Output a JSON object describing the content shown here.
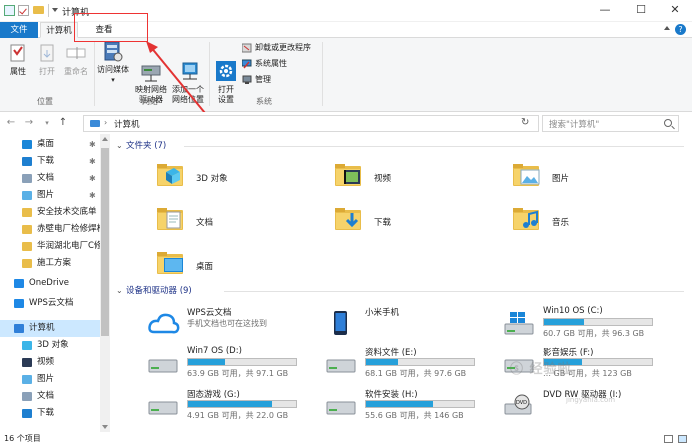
{
  "window": {
    "title": "计算机",
    "minimize": "—",
    "maximize": "☐",
    "close": "✕"
  },
  "tabs": {
    "file": "文件",
    "computer": "计算机",
    "view": "查看"
  },
  "ribbon": {
    "location": {
      "label": "位置",
      "properties": "属性",
      "open": "打开",
      "rename": "重命名"
    },
    "network": {
      "label": "网络",
      "access_media": "访问媒体",
      "map_drive": "映射网络\n驱动器",
      "add_location": "添加一个\n网络位置"
    },
    "system": {
      "label": "系统",
      "open_settings": "打开\n设置",
      "uninstall": "卸载或更改程序",
      "system_properties": "系统属性",
      "manage": "管理"
    }
  },
  "address": {
    "path": "计算机",
    "search_placeholder": "搜索\"计算机\""
  },
  "nav_pane": {
    "items": [
      {
        "label": "桌面",
        "pinned": true,
        "icon": "desktop-icon"
      },
      {
        "label": "下载",
        "pinned": true,
        "icon": "download-icon"
      },
      {
        "label": "文档",
        "pinned": true,
        "icon": "document-icon"
      },
      {
        "label": "图片",
        "pinned": true,
        "icon": "picture-icon"
      },
      {
        "label": "安全技术交底单",
        "pinned": false,
        "icon": "folder-icon"
      },
      {
        "label": "赤壁电厂检修焊材",
        "pinned": false,
        "icon": "folder-icon"
      },
      {
        "label": "华润湖北电厂C修",
        "pinned": false,
        "icon": "folder-icon"
      },
      {
        "label": "施工方案",
        "pinned": false,
        "icon": "folder-icon"
      },
      {
        "label": "OneDrive",
        "pinned": false,
        "icon": "cloud-icon"
      },
      {
        "label": "WPS云文档",
        "pinned": false,
        "icon": "cloud-icon"
      },
      {
        "label": "计算机",
        "pinned": false,
        "icon": "computer-icon"
      },
      {
        "label": "3D 对象",
        "pinned": false,
        "icon": "3d-icon"
      },
      {
        "label": "视频",
        "pinned": false,
        "icon": "video-icon"
      },
      {
        "label": "图片",
        "pinned": false,
        "icon": "picture-icon"
      },
      {
        "label": "文档",
        "pinned": false,
        "icon": "document-icon"
      },
      {
        "label": "下载",
        "pinned": false,
        "icon": "download-icon"
      }
    ]
  },
  "folders": {
    "header": "文件夹 (7)",
    "items": [
      {
        "label": "3D 对象",
        "icon": "3d-objects-icon"
      },
      {
        "label": "视频",
        "icon": "video-folder-icon"
      },
      {
        "label": "图片",
        "icon": "picture-folder-icon"
      },
      {
        "label": "文档",
        "icon": "document-folder-icon"
      },
      {
        "label": "下载",
        "icon": "download-folder-icon"
      },
      {
        "label": "音乐",
        "icon": "music-folder-icon"
      },
      {
        "label": "桌面",
        "icon": "desktop-folder-icon"
      }
    ]
  },
  "devices": {
    "header": "设备和驱动器 (9)",
    "items": [
      {
        "name": "WPS云文档",
        "info": "手机文档也可在这找到",
        "fill": null,
        "icon": "wps-cloud-icon"
      },
      {
        "name": "小米手机",
        "info": "",
        "fill": null,
        "icon": "phone-icon"
      },
      {
        "name": "Win10 OS (C:)",
        "info": "60.7 GB 可用，共 96.3 GB",
        "fill": 0.37,
        "icon": "windows-drive-icon"
      },
      {
        "name": "Win7 OS (D:)",
        "info": "63.9 GB 可用，共 97.1 GB",
        "fill": 0.34,
        "icon": "drive-icon"
      },
      {
        "name": "资料文件 (E:)",
        "info": "68.1 GB 可用，共 97.6 GB",
        "fill": 0.3,
        "icon": "drive-icon"
      },
      {
        "name": "影音娱乐 (F:)",
        "info": "… GB 可用，共 123 GB",
        "fill": 0.35,
        "icon": "drive-icon"
      },
      {
        "name": "固态游戏 (G:)",
        "info": "4.91 GB 可用，共 22.0 GB",
        "fill": 0.78,
        "icon": "drive-icon"
      },
      {
        "name": "软件安装 (H:)",
        "info": "55.6 GB 可用，共 146 GB",
        "fill": 0.62,
        "icon": "drive-icon"
      },
      {
        "name": "DVD RW 驱动器 (I:)",
        "info": "",
        "fill": null,
        "icon": "dvd-drive-icon"
      }
    ]
  },
  "status": {
    "count": "16 个项目"
  },
  "watermark": {
    "text": "ⓢ 经验啦",
    "sub": "jingyanla.com"
  },
  "colors": {
    "accent": "#1979ca",
    "bar_fill": "#26a0da",
    "annotation": "#e33333",
    "folder": "#e9bd4a"
  }
}
